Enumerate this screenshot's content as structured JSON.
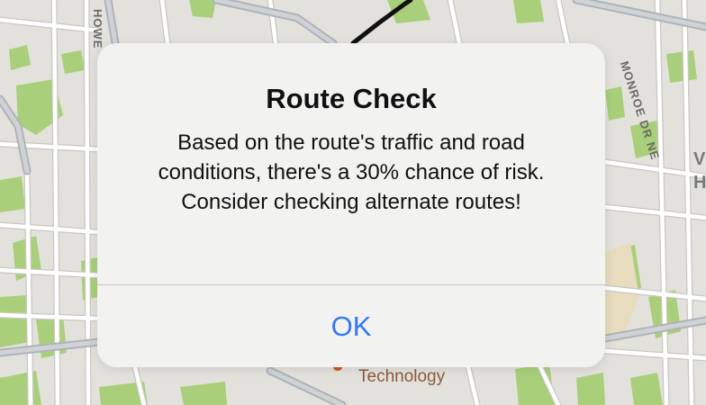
{
  "map": {
    "street_labels": {
      "howell": "HOWE",
      "monroe": "MONROE DR NE"
    },
    "poi_label": "Technology",
    "edge_letters": [
      "V",
      "H"
    ],
    "colors": {
      "land": "#e3e1dc",
      "road": "#ffffff",
      "road_outline": "#c9c7c2",
      "major_road": "#aeb3b8",
      "park": "#a9cf7a",
      "poi": "#c05a2a"
    }
  },
  "alert": {
    "title": "Route Check",
    "message": "Based on the route's traffic and road conditions, there's a 30% chance of risk. Consider checking alternate routes!",
    "ok_label": "OK",
    "colors": {
      "background": "#f2f2f1",
      "button_text": "#3478f6",
      "divider": "#c4c4c4"
    }
  }
}
